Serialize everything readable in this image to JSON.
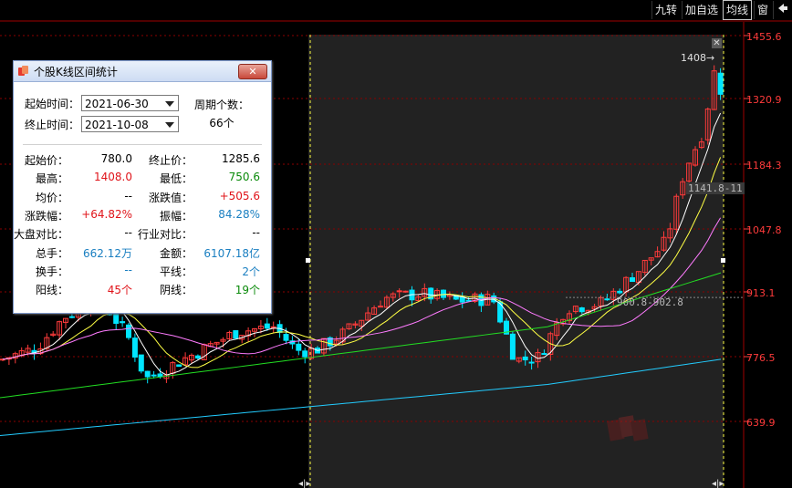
{
  "toolbar": {
    "items": [
      {
        "label": "九转"
      },
      {
        "label": "加自选"
      },
      {
        "label": "均线"
      },
      {
        "label": "窗"
      }
    ],
    "pin_icon": "pin-icon"
  },
  "y_axis": {
    "labels": [
      "1455.6",
      "1320.9",
      "1184.3",
      "1047.8",
      "913.1",
      "776.5",
      "639.9"
    ]
  },
  "markers": {
    "high": "1408",
    "level_high": "1141.8-11",
    "level_low": "900.8-902.8"
  },
  "dialog": {
    "title": "个股K线区间统计",
    "start_label": "起始时间：",
    "start_value": "2021-06-30",
    "end_label": "终止时间：",
    "end_value": "2021-10-08",
    "period_label": "周期个数：",
    "period_value": "66个",
    "stats": [
      {
        "l1": "起始价：",
        "v1": "780.0",
        "c1": "black",
        "l2": "终止价：",
        "v2": "1285.6",
        "c2": "black"
      },
      {
        "l1": "最高：",
        "v1": "1408.0",
        "c1": "red",
        "l2": "最低：",
        "v2": "750.6",
        "c2": "green"
      },
      {
        "l1": "均价：",
        "v1": "--",
        "c1": "black",
        "l2": "涨跌值：",
        "v2": "+505.6",
        "c2": "red"
      },
      {
        "l1": "涨跌幅：",
        "v1": "+64.82%",
        "c1": "red",
        "l2": "振幅：",
        "v2": "84.28%",
        "c2": "blue"
      },
      {
        "l1": "大盘对比：",
        "v1": "--",
        "c1": "black",
        "l2": "行业对比：",
        "v2": "--",
        "c2": "black"
      },
      {
        "l1": "总手：",
        "v1": "662.12万",
        "c1": "blue",
        "l2": "金额：",
        "v2": "6107.18亿",
        "c2": "blue"
      },
      {
        "l1": "换手：",
        "v1": "--",
        "c1": "blue",
        "l2": "平线：",
        "v2": "2个",
        "c2": "blue"
      },
      {
        "l1": "阳线：",
        "v1": "45个",
        "c1": "red",
        "l2": "阴线：",
        "v2": "19个",
        "c2": "green"
      }
    ]
  },
  "colors": {
    "up": "#ff3b3b",
    "down": "#00e5ff",
    "ma5": "#ffffff",
    "ma10": "#ffff44",
    "ma20": "#ff7bff",
    "ma60": "#22dd22",
    "ma250": "#22ccff",
    "grid": "#8b0000"
  }
}
